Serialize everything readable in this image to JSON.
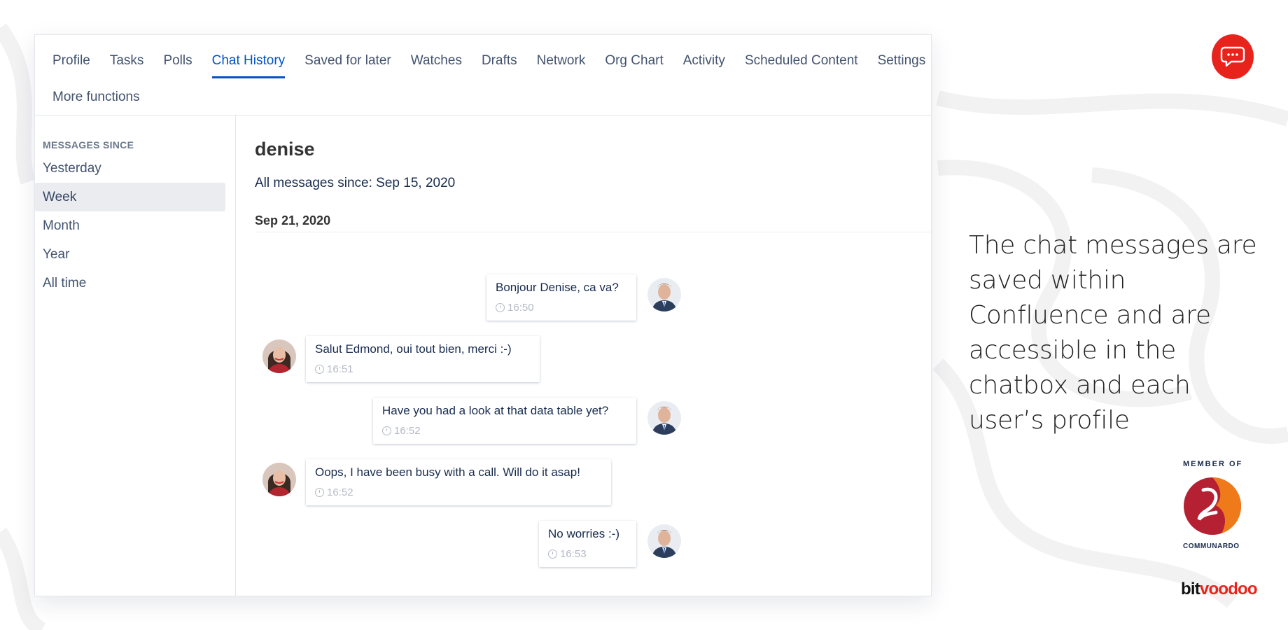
{
  "tabs": {
    "row1": [
      "Profile",
      "Tasks",
      "Polls",
      "Chat History",
      "Saved for later",
      "Watches",
      "Drafts",
      "Network",
      "Org Chart",
      "Activity",
      "Scheduled Content",
      "Settings"
    ],
    "active": "Chat History",
    "more": "More functions"
  },
  "sidebar": {
    "heading": "MESSAGES SINCE",
    "items": [
      {
        "label": "Yesterday",
        "selected": false
      },
      {
        "label": "Week",
        "selected": true
      },
      {
        "label": "Month",
        "selected": false
      },
      {
        "label": "Year",
        "selected": false
      },
      {
        "label": "All time",
        "selected": false
      }
    ]
  },
  "content": {
    "user_name": "denise",
    "since": "All messages since: Sep 15, 2020",
    "date_header": "Sep 21, 2020",
    "messages": [
      {
        "text": "Bonjour Denise, ca va?",
        "time": "16:50",
        "from": "edmond"
      },
      {
        "text": "Salut Edmond, oui tout bien, merci :-)",
        "time": "16:51",
        "from": "denise"
      },
      {
        "text": "Have you had a look at that data table yet?",
        "time": "16:52",
        "from": "edmond"
      },
      {
        "text": "Oops, I have been busy with a call. Will do it asap!",
        "time": "16:52",
        "from": "denise"
      },
      {
        "text": "No worries :-)",
        "time": "16:53",
        "from": "edmond"
      }
    ]
  },
  "promo": {
    "text": "The chat messages are saved within Confluence and are accessible in the chatbox and each user’s profile",
    "member_of": "MEMBER OF",
    "communardo": "COMMUNARDO",
    "brand_part1": "bit",
    "brand_part2": "voodoo"
  },
  "colors": {
    "accent": "#0052cc",
    "brand_red": "#e8231c"
  }
}
